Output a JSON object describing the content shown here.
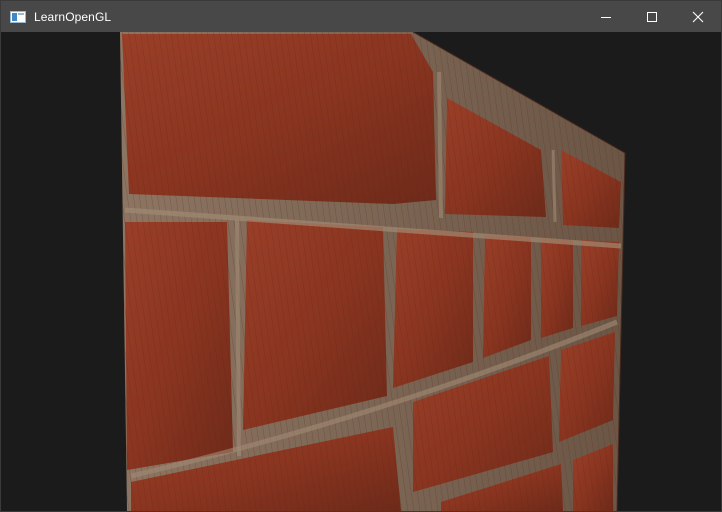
{
  "window": {
    "title": "LearnOpenGL",
    "icon": "window-app-icon",
    "titlebar_color": "#484848",
    "background_color": "#1b1b1b"
  },
  "caption_buttons": {
    "minimize_icon": "minimize-icon",
    "maximize_icon": "maximize-icon",
    "close_icon": "close-icon"
  },
  "scene": {
    "description_icon": "brick-wall-parallax-render",
    "brick_color": "#8f3a24",
    "mortar_color": "#7a6552"
  }
}
